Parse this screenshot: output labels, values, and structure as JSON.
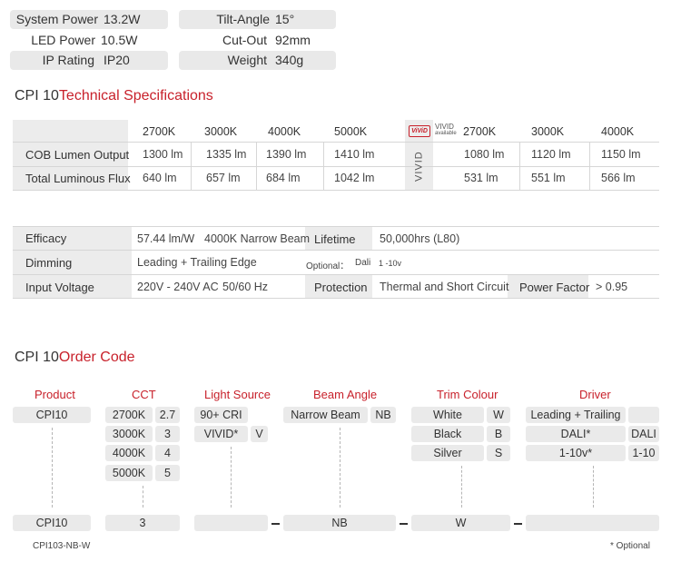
{
  "top_specs": {
    "system_power": {
      "key": "System Power",
      "value": "13.2W"
    },
    "led_power": {
      "key": "LED Power",
      "value": "10.5W"
    },
    "ip_rating": {
      "key": "IP Rating",
      "value": "IP20"
    },
    "tilt_angle": {
      "key": "Tilt-Angle",
      "value": "15°"
    },
    "cut_out": {
      "key": "Cut-Out",
      "value": "92mm"
    },
    "weight": {
      "key": "Weight",
      "value": "340g"
    }
  },
  "tech_title": {
    "model": "CPI 10",
    "heading": "Technical Specifications"
  },
  "lumen_table": {
    "standard_ccts": [
      "2700K",
      "3000K",
      "4000K",
      "5000K"
    ],
    "vivid_ccts": [
      "2700K",
      "3000K",
      "4000K"
    ],
    "vivid_badge": "ViViD",
    "vivid_available": "VIVID",
    "vivid_available_sub": "available",
    "vivid_vertical": "VIVID",
    "rows": [
      {
        "label": "COB Lumen Output",
        "standard": [
          "1300 lm",
          "1335 lm",
          "1390 lm",
          "1410 lm"
        ],
        "vivid": [
          "1080 lm",
          "1120 lm",
          "1150 lm"
        ]
      },
      {
        "label": "Total Luminous Flux",
        "standard": [
          "640 lm",
          "657 lm",
          "684 lm",
          "1042 lm"
        ],
        "vivid": [
          "531 lm",
          "551 lm",
          "566 lm"
        ]
      }
    ]
  },
  "electrical": {
    "efficacy_label": "Efficacy",
    "efficacy_value": "57.44 lm/W",
    "efficacy_note": "4000K Narrow Beam",
    "lifetime_label": "Lifetime",
    "lifetime_value": "50,000hrs (L80)",
    "dimming_label": "Dimming",
    "dimming_value": "Leading + Trailing Edge",
    "optional_label": "Optional：",
    "optional_dali": "Dali",
    "optional_110": "1 -10v",
    "input_label": "Input Voltage",
    "input_value": "220V - 240V AC",
    "input_freq": "50/60 Hz",
    "protection_label": "Protection",
    "protection_value": "Thermal and Short Circuit",
    "pf_label": "Power Factor",
    "pf_value": "> 0.95"
  },
  "order_title": {
    "model": "CPI 10",
    "heading": "Order Code"
  },
  "order_code": {
    "headers": {
      "product": "Product",
      "cct": "CCT",
      "light_source": "Light Source",
      "beam": "Beam Angle",
      "trim": "Trim Colour",
      "driver": "Driver"
    },
    "product": "CPI10",
    "cct": [
      {
        "label": "2700K",
        "code": "2.7"
      },
      {
        "label": "3000K",
        "code": "3"
      },
      {
        "label": "4000K",
        "code": "4"
      },
      {
        "label": "5000K",
        "code": "5"
      }
    ],
    "light_source": [
      {
        "label": "90+ CRI",
        "code": ""
      },
      {
        "label": "VIVID*",
        "code": "V"
      }
    ],
    "beam": [
      {
        "label": "Narrow Beam",
        "code": "NB"
      }
    ],
    "trim": [
      {
        "label": "White",
        "code": "W"
      },
      {
        "label": "Black",
        "code": "B"
      },
      {
        "label": "Silver",
        "code": "S"
      }
    ],
    "driver": [
      {
        "label": "Leading + Trailing",
        "code": ""
      },
      {
        "label": "DALI*",
        "code": "DALI"
      },
      {
        "label": "1-10v*",
        "code": "1-10"
      }
    ],
    "example": {
      "product": "CPI10",
      "cct": "3",
      "light_source": "",
      "beam": "NB",
      "trim": "W",
      "driver": ""
    },
    "example_code": "CPI103-NB-W",
    "optional_note": "* Optional"
  }
}
